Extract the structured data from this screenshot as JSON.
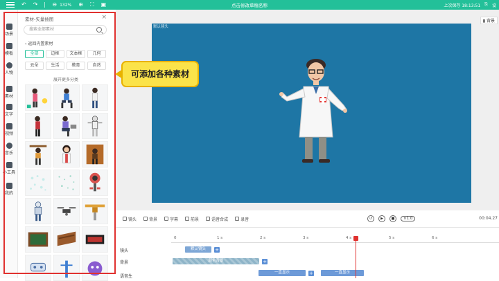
{
  "topbar": {
    "zoom": "132%",
    "title": "点击修改草稿名称",
    "save_time": "上次保存 18:13:51",
    "settings_label": "设"
  },
  "nav": [
    {
      "label": "场景"
    },
    {
      "label": "模板"
    },
    {
      "label": "人物"
    },
    {
      "label": "素材"
    },
    {
      "label": "文字"
    },
    {
      "label": "视频"
    },
    {
      "label": "音乐"
    },
    {
      "label": "小工具"
    },
    {
      "label": "我的"
    }
  ],
  "panel": {
    "title": "素材-矢量插图",
    "search_placeholder": "搜索全部素材",
    "back_label": "返回内置素材",
    "categories": [
      "全部",
      "边框",
      "文本框",
      "几何",
      "云朵",
      "生活",
      "教育",
      "自然"
    ],
    "expand_label": "展开更多分类"
  },
  "callout": {
    "text": "可添加各种素材"
  },
  "canvas": {
    "label": "默认镜头",
    "bg_button": "背景",
    "bg_color": "#1e76a5"
  },
  "toolbar": {
    "lens": "镜头",
    "background": "背景",
    "subtitle": "字幕",
    "foreground": "前景",
    "voice": "语音合成",
    "effect": "录音",
    "speed": "1.0",
    "time": "00:04.27"
  },
  "timeline": {
    "ticks": [
      "0",
      "1 s",
      "2 s",
      "3 s",
      "4 s",
      "5 s",
      "6 s"
    ],
    "tracks": {
      "lens": "镜头",
      "bg": "背景",
      "voice": "语音生"
    },
    "lens_clip": "默认镜头",
    "bg_clip": "颜色背景",
    "show_clip_1": "一直显示",
    "show_clip_2": "一直显示"
  },
  "colors": {
    "brand": "#23c099",
    "highlight": "#e0312f",
    "callout": "#fbe34a"
  }
}
